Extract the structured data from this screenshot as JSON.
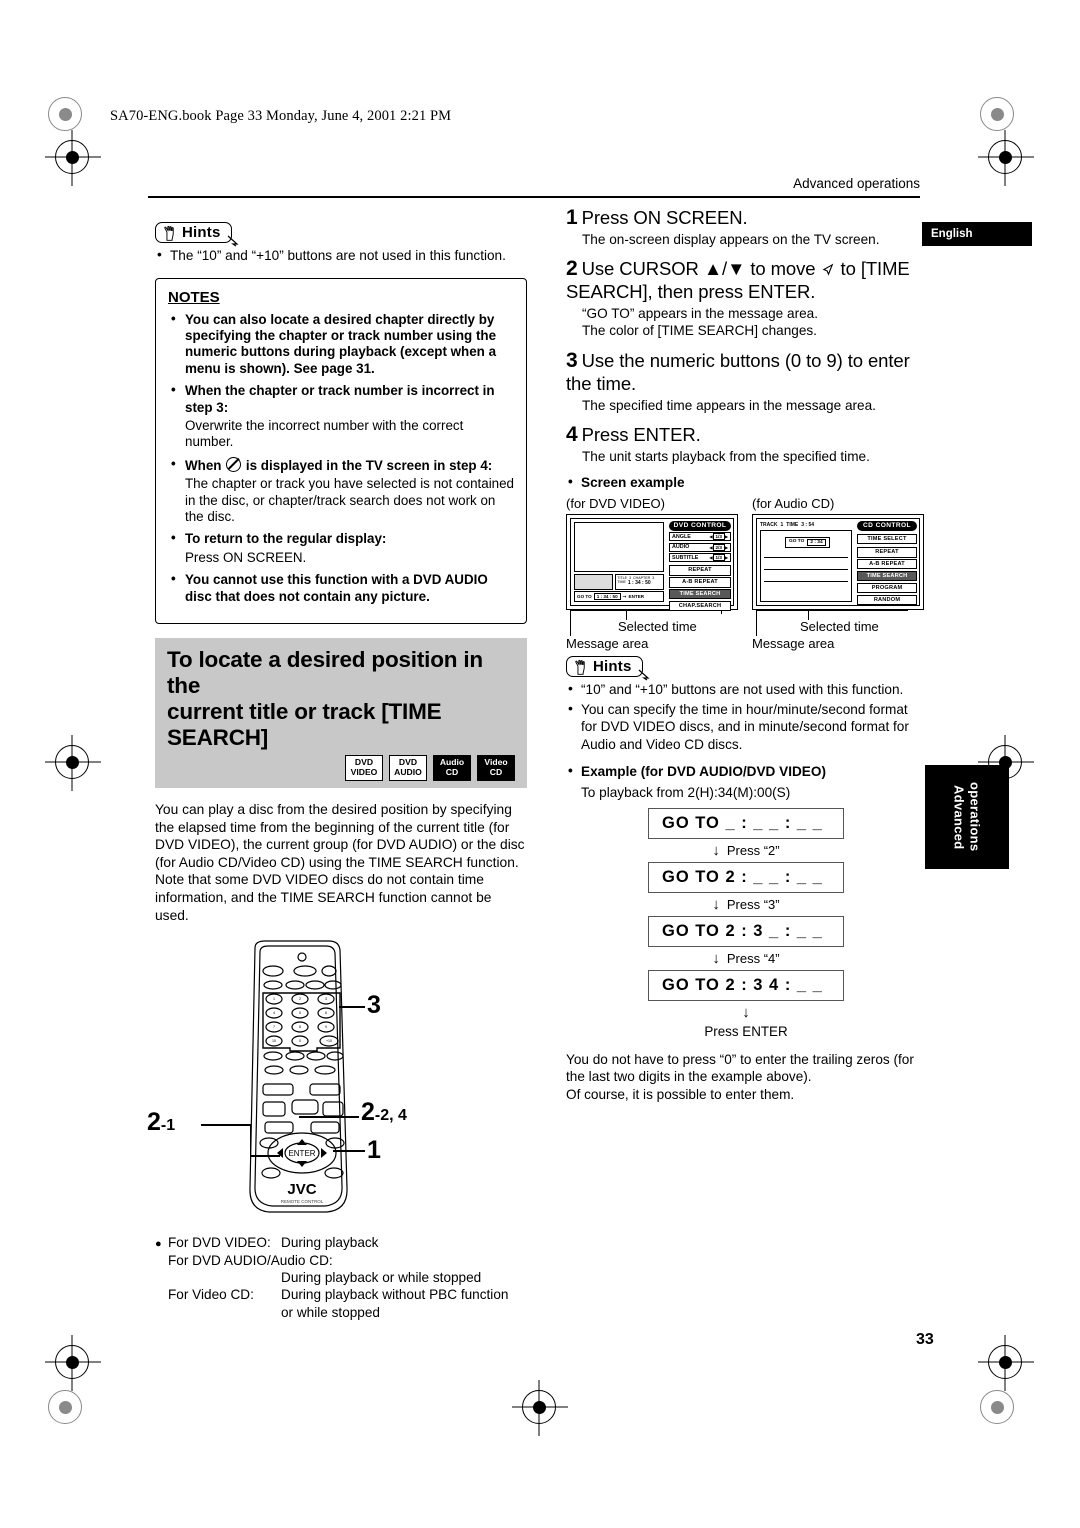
{
  "file_header": "SA70-ENG.book  Page 33  Monday, June 4, 2001  2:21 PM",
  "running_head": "Advanced operations",
  "page_number": "33",
  "tabs": {
    "language": "English",
    "side_line1": "Advanced",
    "side_line2": "operations"
  },
  "left": {
    "hints_label": "Hints",
    "hints_items": [
      "The “10” and “+10” buttons are not used in this function."
    ],
    "notes_title": "NOTES",
    "notes": [
      {
        "bold": "You can also locate a desired chapter directly by specifying the chapter or track number using the numeric buttons during playback (except when a menu is shown). See page 31.",
        "plain": ""
      },
      {
        "bold": "When the chapter or track number is incorrect in step 3:",
        "plain": "Overwrite the incorrect number with the correct number."
      },
      {
        "bold_pre": "When",
        "bold_post": "is displayed in the TV screen in step 4:",
        "plain": "The chapter or track you have selected is not contained in the disc, or chapter/track search does not work on the disc.",
        "icon": "no-entry-icon"
      },
      {
        "bold": "To return to the regular display:",
        "plain": "Press ON SCREEN."
      },
      {
        "bold": "You cannot use this function with a DVD AUDIO disc that does not contain any picture.",
        "plain": ""
      }
    ],
    "section_title_line1": "To locate a desired position in the",
    "section_title_line2": "current title or track [TIME SEARCH]",
    "badges": [
      {
        "line1": "DVD",
        "line2": "VIDEO",
        "dark": false
      },
      {
        "line1": "DVD",
        "line2": "AUDIO",
        "dark": false
      },
      {
        "line1": "Audio",
        "line2": "CD",
        "dark": true
      },
      {
        "line1": "Video",
        "line2": "CD",
        "dark": true
      }
    ],
    "body": "You can play a disc from the desired position by specifying the elapsed time from the beginning of the current title (for DVD VIDEO), the current group (for DVD AUDIO) or the disc (for Audio CD/Video CD) using the TIME SEARCH function.\nNote that some DVD VIDEO discs do not contain time information, and the TIME SEARCH function cannot be used.",
    "remote_callouts": {
      "numeric": "3",
      "cursor": "2",
      "cursor_sub": "-1",
      "enter": "2",
      "enter_sub": "-2, 4",
      "onscreen": "1"
    },
    "remote_brand": "JVC",
    "remote_sub": "REMOTE CONTROL",
    "availability": [
      {
        "label": "For DVD VIDEO:",
        "value": "During playback"
      },
      {
        "label": "For DVD AUDIO/Audio CD:",
        "value": ""
      },
      {
        "label": "",
        "value": "During playback or while stopped"
      },
      {
        "label": "For Video CD:",
        "value": "During playback without PBC function"
      },
      {
        "label": "",
        "value": "or while stopped"
      }
    ]
  },
  "right": {
    "steps": [
      {
        "num": "1",
        "title": "Press ON SCREEN.",
        "detail": "The on-screen display appears on the TV screen."
      },
      {
        "num": "2",
        "title_a": "Use CURSOR ▲/▼ to move",
        "title_b": "to [TIME SEARCH],  then press ENTER.",
        "detail": "“GO TO” appears in the message area.\nThe color of [TIME SEARCH] changes."
      },
      {
        "num": "3",
        "title": "Use the numeric buttons (0 to 9) to enter the time.",
        "detail": "The specified time appears in the message area."
      },
      {
        "num": "4",
        "title": "Press ENTER.",
        "detail": "The unit starts playback from the specified time."
      }
    ],
    "screen_example_label": "Screen example",
    "screens": [
      {
        "caption": "(for DVD VIDEO)",
        "panel_title": "DVD CONTROL",
        "rows": [
          {
            "name": "ANGLE",
            "value": "1/3"
          },
          {
            "name": "AUDIO",
            "value": "2/3"
          },
          {
            "name": "SUBTITLE",
            "value": "1/3"
          }
        ],
        "buttons": [
          {
            "label": "REPEAT",
            "highlight": false
          },
          {
            "label": "A-B REPEAT",
            "highlight": false
          },
          {
            "label": "TIME SEARCH",
            "highlight": true
          },
          {
            "label": "CHAP.SEARCH",
            "highlight": false
          }
        ],
        "info": {
          "title_label": "TITLE",
          "title_value": "3",
          "chapter_label": "CHAPTER",
          "chapter_value": "3",
          "time_label": "TIME",
          "time_value": "1 : 34 : 50"
        },
        "message": {
          "goto": "GO TO",
          "value": "1 : 34 : 50",
          "enter": "ENTER"
        },
        "cap_time": "Selected time",
        "cap_msg": "Message area"
      },
      {
        "caption": "(for Audio CD)",
        "panel_title": "CD CONTROL",
        "track_label": "TRACK",
        "track_value": "1",
        "time_label": "TIME",
        "time_value": "3 : 54",
        "buttons": [
          {
            "label": "TIME SELECT",
            "highlight": false
          },
          {
            "label": "REPEAT",
            "highlight": false
          },
          {
            "label": "A-B REPEAT",
            "highlight": false
          },
          {
            "label": "TIME SEARCH",
            "highlight": true
          },
          {
            "label": "PROGRAM",
            "highlight": false
          },
          {
            "label": "RANDOM",
            "highlight": false
          }
        ],
        "message": {
          "goto": "GO TO",
          "value": "2 : 34"
        },
        "cap_time": "Selected time",
        "cap_msg": "Message area"
      }
    ],
    "hints_label": "Hints",
    "hints_items": [
      "“10” and “+10” buttons are not used with this function.",
      "You can specify the time in hour/minute/second format for DVD VIDEO discs, and in minute/second format for Audio and Video CD discs."
    ],
    "example_heading": "Example (for DVD AUDIO/DVD VIDEO)",
    "example_sub": "To playback from 2(H):34(M):00(S)",
    "goto_sequence": [
      {
        "display": "GO TO  _ : _ _ : _ _",
        "arrow": "Press “2”"
      },
      {
        "display": "GO TO  2 : _ _ : _ _",
        "arrow": "Press “3”"
      },
      {
        "display": "GO TO  2 : 3 _ : _ _",
        "arrow": "Press “4”"
      },
      {
        "display": "GO TO  2 : 3 4 : _ _",
        "arrow": ""
      }
    ],
    "press_enter": "Press ENTER",
    "closing": "You do not have to press “0” to enter the trailing zeros (for the last two digits in the example above).\nOf course, it is possible to enter them."
  }
}
